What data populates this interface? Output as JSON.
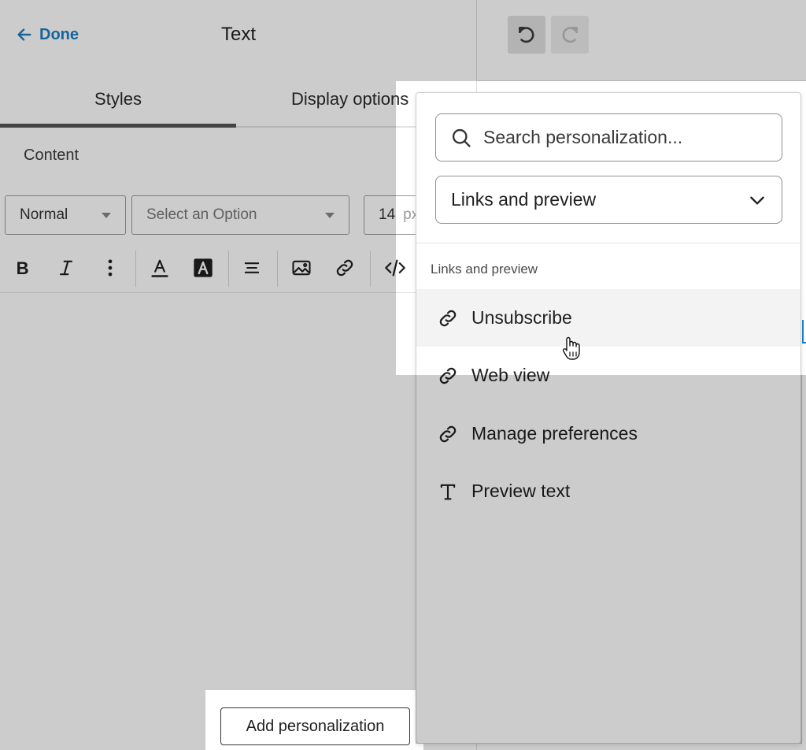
{
  "header": {
    "done_label": "Done",
    "title": "Text"
  },
  "tabs": [
    {
      "label": "Styles",
      "active": true
    },
    {
      "label": "Display options",
      "active": false
    }
  ],
  "content": {
    "section_label": "Content",
    "style_select": "Normal",
    "font_select_placeholder": "Select an Option",
    "font_size_value": "14",
    "font_size_unit": "px"
  },
  "toolbar": {
    "icons": [
      "bold-icon",
      "italic-icon",
      "more-vertical-icon",
      "text-color-icon",
      "highlight-color-icon",
      "align-center-icon",
      "image-icon",
      "link-icon",
      "code-icon"
    ]
  },
  "add_personalization_label": "Add personalization",
  "popover": {
    "search_placeholder": "Search personalization...",
    "category_selected": "Links and preview",
    "group_label": "Links and preview",
    "items": [
      {
        "label": "Unsubscribe",
        "icon": "link-icon",
        "hovered": true
      },
      {
        "label": "Web view",
        "icon": "link-icon",
        "hovered": false
      },
      {
        "label": "Manage preferences",
        "icon": "link-icon",
        "hovered": false
      },
      {
        "label": "Preview text",
        "icon": "text-type-icon",
        "hovered": false
      }
    ]
  },
  "colors": {
    "accent": "#1b7ec2",
    "overlay": "rgba(0,0,0,0.2)",
    "hover_row": "#f3f3f3"
  }
}
